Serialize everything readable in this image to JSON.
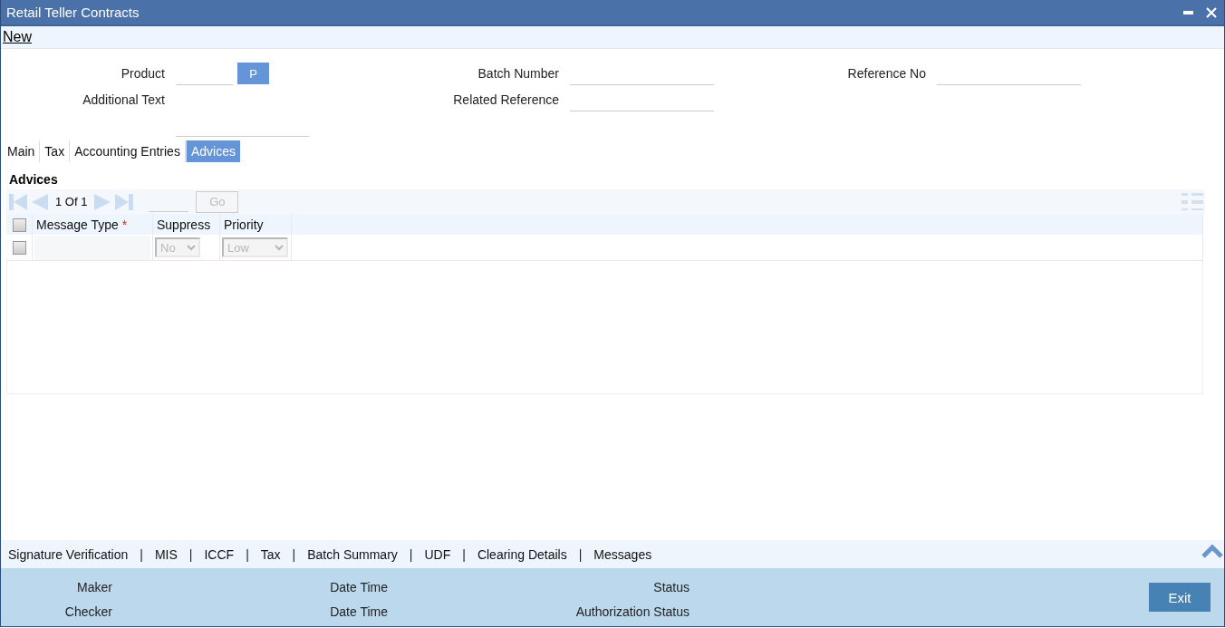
{
  "window": {
    "title": "Retail Teller Contracts"
  },
  "toolbar": {
    "new_link": "New"
  },
  "field_columns": [
    {
      "fields": [
        {
          "label": "Product",
          "kind": "lookup",
          "button": "P"
        },
        {
          "label": "Additional Text",
          "kind": "textarea"
        }
      ]
    },
    {
      "fields": [
        {
          "label": "Batch Number",
          "kind": "text"
        },
        {
          "label": "Related Reference",
          "kind": "text"
        }
      ]
    },
    {
      "fields": [
        {
          "label": "Reference No",
          "kind": "text"
        }
      ]
    }
  ],
  "tabs": [
    {
      "label": "Main",
      "selected": false
    },
    {
      "label": "Tax",
      "selected": false
    },
    {
      "label": "Accounting Entries",
      "selected": false
    },
    {
      "label": "Advices",
      "selected": true
    }
  ],
  "advices": {
    "title": "Advices",
    "pager": {
      "current": "1",
      "of": "Of",
      "total": "1",
      "go": "Go"
    },
    "select_all_checked": false,
    "columns": [
      {
        "label": "Message Type",
        "marker": "*"
      },
      {
        "label": "Suppress"
      },
      {
        "label": "Priority"
      }
    ],
    "rows": [
      {
        "checked": false,
        "suppress": "No",
        "priority": "Low"
      }
    ]
  },
  "footer_links": [
    {
      "kind": "link",
      "label": "Signature Verification"
    },
    {
      "kind": "separator",
      "label": "|"
    },
    {
      "kind": "link",
      "label": "MIS"
    },
    {
      "kind": "separator",
      "label": "|"
    },
    {
      "kind": "link",
      "label": "ICCF"
    },
    {
      "kind": "separator",
      "label": "|"
    },
    {
      "kind": "link",
      "label": "Tax"
    },
    {
      "kind": "separator",
      "label": "|"
    },
    {
      "kind": "link",
      "label": "Batch Summary"
    },
    {
      "kind": "separator",
      "label": "|"
    },
    {
      "kind": "link",
      "label": "UDF"
    },
    {
      "kind": "separator",
      "label": "|"
    },
    {
      "kind": "link",
      "label": "Clearing Details"
    },
    {
      "kind": "separator",
      "label": "|"
    },
    {
      "kind": "link",
      "label": "Messages"
    }
  ],
  "audit": [
    [
      "Maker",
      "Date Time",
      "Status"
    ],
    [
      "Checker",
      "Date Time",
      "Authorization Status"
    ]
  ],
  "exit_button": "Exit"
}
